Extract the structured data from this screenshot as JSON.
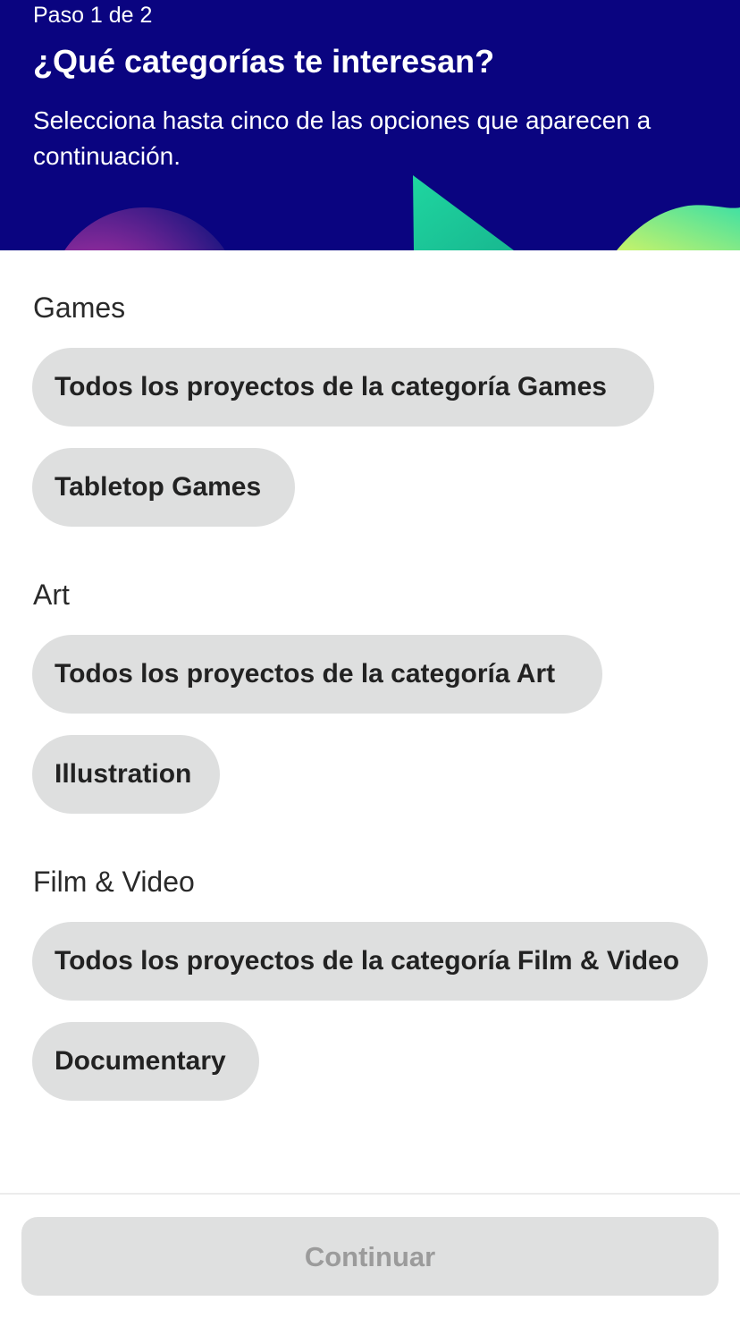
{
  "header": {
    "step": "Paso 1 de 2",
    "title": "¿Qué categorías te interesan?",
    "subtitle": "Selecciona hasta cinco de las opciones que aparecen a continuación.",
    "colors": {
      "background": "#0a0480",
      "accent_pink": "#e8236e",
      "accent_teal": "#1fd6a0",
      "accent_lime": "#b6f26c"
    }
  },
  "sections": [
    {
      "title": "Games",
      "options": [
        "Todos los proyectos de la categoría Games",
        "Tabletop Games"
      ]
    },
    {
      "title": "Art",
      "options": [
        "Todos los proyectos de la categoría Art",
        "Illustration"
      ]
    },
    {
      "title": "Film & Video",
      "options": [
        "Todos los proyectos de la categoría Film & Video",
        "Documentary"
      ]
    }
  ],
  "footer": {
    "continue_label": "Continuar",
    "continue_enabled": false
  }
}
